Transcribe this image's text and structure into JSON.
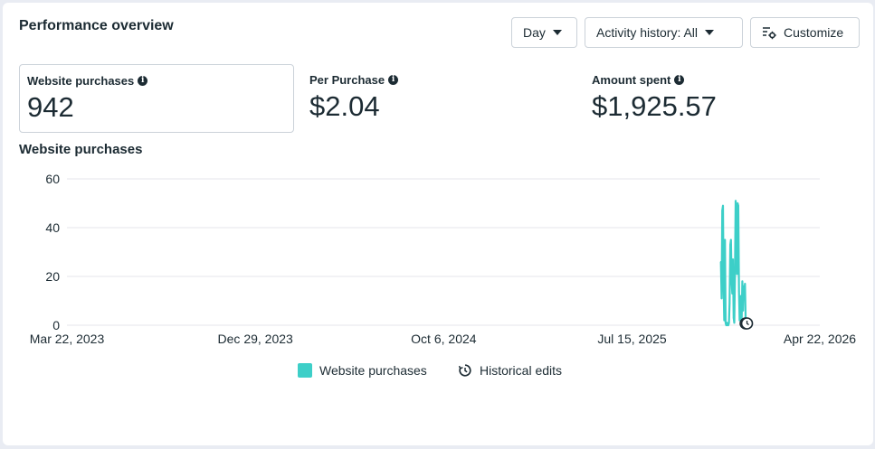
{
  "header": {
    "title": "Performance overview"
  },
  "controls": {
    "day_label": "Day",
    "activity_label": "Activity history: All",
    "customize_label": "Customize"
  },
  "metrics": [
    {
      "label": "Website purchases",
      "value": "942"
    },
    {
      "label": "Per Purchase",
      "value": "$2.04"
    },
    {
      "label": "Amount spent",
      "value": "$1,925.57"
    }
  ],
  "chart_section_title": "Website purchases",
  "colors": {
    "series": "#3dcfc8",
    "grid": "#e4e6eb",
    "text": "#1c2b33"
  },
  "legend": {
    "series_label": "Website purchases",
    "edits_label": "Historical edits"
  },
  "chart_data": {
    "type": "line",
    "ylim": [
      0,
      60
    ],
    "yticks": [
      "0",
      "20",
      "40",
      "60"
    ],
    "xlim": [
      "2023-03-22",
      "2026-04-22"
    ],
    "xtick_labels": [
      "Mar 22, 2023",
      "Dec 29, 2023",
      "Oct 6, 2024",
      "Jul 15, 2025",
      "Apr 22, 2026"
    ],
    "xtick_dates": [
      "2023-03-22",
      "2023-12-29",
      "2024-10-06",
      "2025-07-15",
      "2026-04-22"
    ],
    "series": [
      {
        "name": "Website purchases",
        "points": [
          [
            "2025-11-25",
            26
          ],
          [
            "2025-11-26",
            11
          ],
          [
            "2025-11-27",
            47
          ],
          [
            "2025-11-28",
            49
          ],
          [
            "2025-11-29",
            15
          ],
          [
            "2025-11-30",
            2
          ],
          [
            "2025-12-01",
            35
          ],
          [
            "2025-12-02",
            1
          ],
          [
            "2025-12-03",
            0
          ],
          [
            "2025-12-04",
            1
          ],
          [
            "2025-12-05",
            0
          ],
          [
            "2025-12-06",
            0
          ],
          [
            "2025-12-07",
            1
          ],
          [
            "2025-12-08",
            9
          ],
          [
            "2025-12-09",
            33
          ],
          [
            "2025-12-10",
            35
          ],
          [
            "2025-12-11",
            18
          ],
          [
            "2025-12-12",
            13
          ],
          [
            "2025-12-13",
            27
          ],
          [
            "2025-12-14",
            3
          ],
          [
            "2025-12-15",
            1
          ],
          [
            "2025-12-16",
            20
          ],
          [
            "2025-12-17",
            51
          ],
          [
            "2025-12-18",
            42
          ],
          [
            "2025-12-19",
            21
          ],
          [
            "2025-12-20",
            50
          ],
          [
            "2025-12-21",
            49
          ],
          [
            "2025-12-22",
            14
          ],
          [
            "2025-12-23",
            2
          ],
          [
            "2025-12-24",
            3
          ],
          [
            "2025-12-25",
            12
          ],
          [
            "2025-12-26",
            1
          ],
          [
            "2025-12-27",
            18
          ],
          [
            "2025-12-28",
            6
          ],
          [
            "2025-12-29",
            16
          ],
          [
            "2025-12-30",
            13
          ],
          [
            "2025-12-31",
            17
          ],
          [
            "2026-01-01",
            1
          ],
          [
            "2026-01-02",
            0
          ],
          [
            "2026-01-03",
            2
          ]
        ]
      }
    ],
    "historical_edit_dates": [
      "2026-01-01",
      "2026-01-03"
    ]
  }
}
